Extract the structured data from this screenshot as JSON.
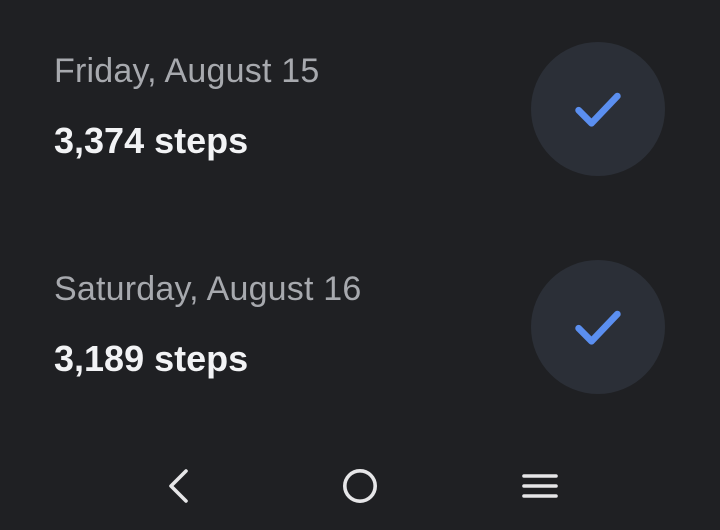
{
  "days": [
    {
      "date": "Friday, August 15",
      "steps": "3,374 steps",
      "completed": true,
      "icon": "checkmark-icon"
    },
    {
      "date": "Saturday, August 16",
      "steps": "3,189 steps",
      "completed": true,
      "icon": "checkmark-icon"
    }
  ],
  "navigation": {
    "back_icon": "back-chevron-icon",
    "home_icon": "home-circle-icon",
    "recents_icon": "recent-apps-icon"
  },
  "colors": {
    "background": "#1f2023",
    "check_circle": "#2b2f37",
    "check_accent": "#5b8ff0",
    "date_text": "#a7a9ae",
    "steps_text": "#f2f3f5",
    "nav_icon": "#e6e6e8"
  }
}
